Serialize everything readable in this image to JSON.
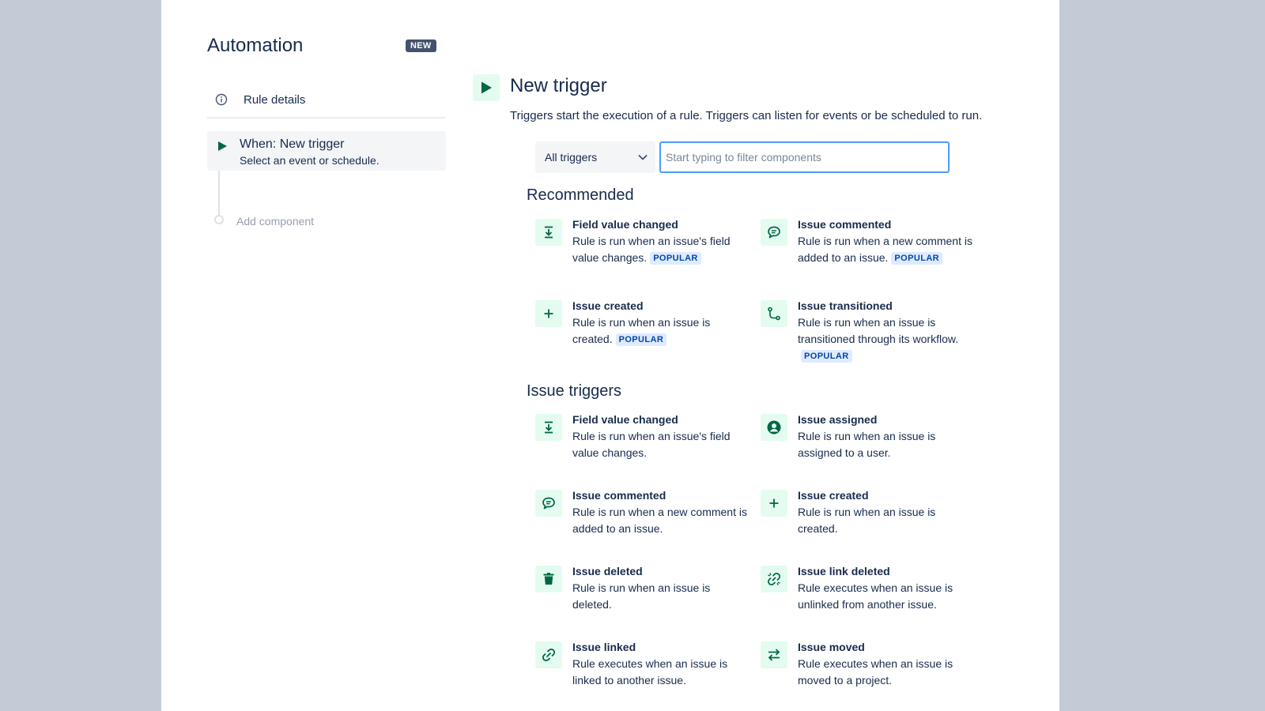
{
  "sidebar": {
    "title": "Automation",
    "badge": "NEW",
    "rule_details": "Rule details",
    "trigger_step": {
      "title": "When: New trigger",
      "subtitle": "Select an event or schedule."
    },
    "add_component": "Add component"
  },
  "main": {
    "title": "New trigger",
    "description": "Triggers start the execution of a rule. Triggers can listen for events or be scheduled to run.",
    "filter": {
      "selected": "All triggers",
      "placeholder": "Start typing to filter components"
    },
    "popular_label": "POPULAR",
    "recommended": {
      "title": "Recommended",
      "items": [
        {
          "name": "Field value changed",
          "desc": "Rule is run when an issue's field value changes.",
          "icon": "field-change-icon"
        },
        {
          "name": "Issue commented",
          "desc": "Rule is run when a new comment is added to an issue.",
          "icon": "comment-icon"
        },
        {
          "name": "Issue created",
          "desc": "Rule is run when an issue is created.",
          "icon": "plus-icon"
        },
        {
          "name": "Issue transitioned",
          "desc": "Rule is run when an issue is transitioned through its workflow.",
          "icon": "transition-icon"
        }
      ]
    },
    "issue_triggers": {
      "title": "Issue triggers",
      "items": [
        {
          "name": "Field value changed",
          "desc": "Rule is run when an issue's field value changes.",
          "icon": "field-change-icon"
        },
        {
          "name": "Issue assigned",
          "desc": "Rule is run when an issue is assigned to a user.",
          "icon": "user-icon"
        },
        {
          "name": "Issue commented",
          "desc": "Rule is run when a new comment is added to an issue.",
          "icon": "comment-icon"
        },
        {
          "name": "Issue created",
          "desc": "Rule is run when an issue is created.",
          "icon": "plus-icon"
        },
        {
          "name": "Issue deleted",
          "desc": "Rule is run when an issue is deleted.",
          "icon": "trash-icon"
        },
        {
          "name": "Issue link deleted",
          "desc": "Rule executes when an issue is unlinked from another issue.",
          "icon": "unlink-icon"
        },
        {
          "name": "Issue linked",
          "desc": "Rule executes when an issue is linked to another issue.",
          "icon": "link-icon"
        },
        {
          "name": "Issue moved",
          "desc": "Rule executes when an issue is moved to a project.",
          "icon": "move-icon"
        }
      ]
    }
  },
  "colors": {
    "accent": "#006644",
    "icon_bg": "#e3fcef",
    "input_focus": "#4c9aff",
    "popular_bg": "#deebff",
    "popular_text": "#0747a6"
  }
}
